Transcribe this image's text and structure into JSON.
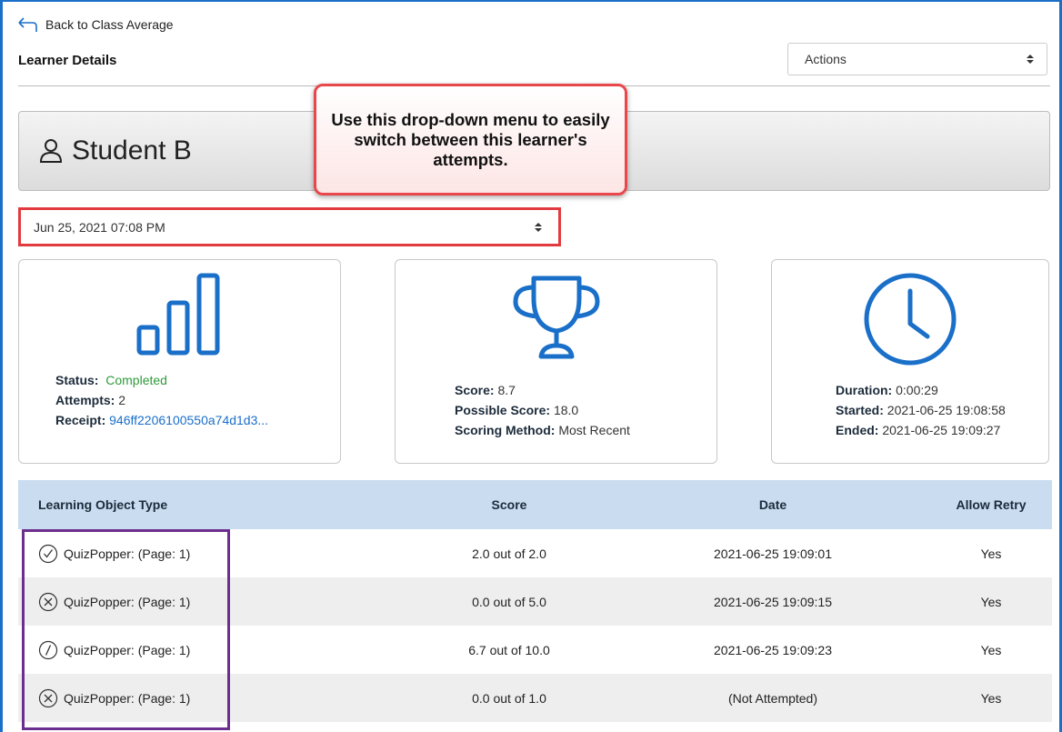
{
  "nav": {
    "back_label": "Back to Class Average"
  },
  "page": {
    "title": "Learner Details"
  },
  "actions": {
    "selected": "Actions"
  },
  "student": {
    "name": "Student B"
  },
  "callout": {
    "text": "Use this drop-down menu to easily switch between this learner's attempts."
  },
  "attempt_select": {
    "selected": "Jun 25, 2021 07:08 PM"
  },
  "cards": {
    "status": {
      "icon": "bar-chart-icon",
      "status_label": "Status:",
      "status_value": "Completed",
      "attempts_label": "Attempts:",
      "attempts_value": "2",
      "receipt_label": "Receipt:",
      "receipt_value": "946ff2206100550a74d1d3..."
    },
    "score": {
      "icon": "trophy-icon",
      "score_label": "Score:",
      "score_value": "8.7",
      "possible_label": "Possible Score:",
      "possible_value": "18.0",
      "method_label": "Scoring Method:",
      "method_value": "Most Recent"
    },
    "time": {
      "icon": "clock-icon",
      "duration_label": "Duration:",
      "duration_value": "0:00:29",
      "started_label": "Started:",
      "started_value": "2021-06-25 19:08:58",
      "ended_label": "Ended:",
      "ended_value": "2021-06-25 19:09:27"
    }
  },
  "table": {
    "headers": [
      "Learning Object Type",
      "Score",
      "Date",
      "Allow Retry"
    ],
    "rows": [
      {
        "icon": "check-circle-icon",
        "type": "QuizPopper: (Page: 1)",
        "score": "2.0 out of 2.0",
        "date": "2021-06-25 19:09:01",
        "retry": "Yes"
      },
      {
        "icon": "x-circle-icon",
        "type": "QuizPopper: (Page: 1)",
        "score": "0.0 out of 5.0",
        "date": "2021-06-25 19:09:15",
        "retry": "Yes"
      },
      {
        "icon": "partial-circle-icon",
        "type": "QuizPopper: (Page: 1)",
        "score": "6.7 out of 10.0",
        "date": "2021-06-25 19:09:23",
        "retry": "Yes"
      },
      {
        "icon": "x-circle-icon",
        "type": "QuizPopper: (Page: 1)",
        "score": "0.0 out of 1.0",
        "date": "(Not Attempted)",
        "retry": "Yes"
      }
    ]
  },
  "colors": {
    "accent": "#1a6fc9",
    "completed": "#2f9b3a",
    "header_bg": "#c9dcf0",
    "callout_border": "#e8474b",
    "highlight_purple": "#6d2f8f"
  }
}
